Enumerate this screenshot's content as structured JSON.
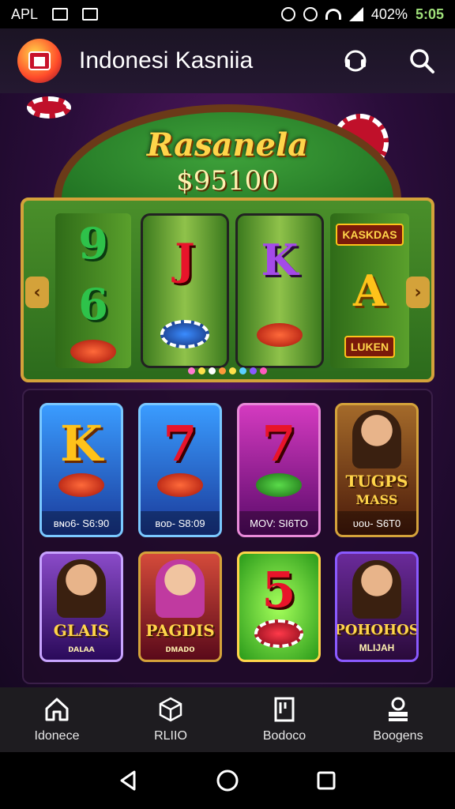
{
  "status_bar": {
    "carrier": "APL",
    "battery": "402%",
    "time": "5:05"
  },
  "app_bar": {
    "title": "Indonesi Kasniia"
  },
  "banner": {
    "title": "Rasanela",
    "amount": "$95100"
  },
  "slot": {
    "reel1_symbols": [
      "9",
      "6"
    ],
    "reel2_symbols": [
      "J"
    ],
    "reel3_symbols": [
      "K"
    ],
    "reel4_symbols": [
      "A"
    ],
    "reel4_badge": "KASKDAS",
    "reel4_bottom_badge": "LUKEN"
  },
  "game_cards": [
    {
      "symbol": "K",
      "caption": "ʙɴᴏ6- S6:90"
    },
    {
      "symbol": "7",
      "caption": "ʙᴏᴅ- S8:09"
    },
    {
      "symbol": "7",
      "caption": "MOV: SI6TO"
    },
    {
      "title": "TUGPS",
      "subtitle": "MASS",
      "caption": "ᴜᴏᴜ- S6T0"
    },
    {
      "title": "GLAIS",
      "subtitle": "ᴅᴀʟᴀᴀ"
    },
    {
      "title": "PAGDIS",
      "subtitle": "ᴅᴍᴀᴅᴏ"
    },
    {
      "symbol": "5"
    },
    {
      "title": "POHOHOS",
      "subtitle": "MLIJAH"
    }
  ],
  "bottom_nav": [
    {
      "label": "Idonece",
      "icon": "home-icon"
    },
    {
      "label": "RLIIO",
      "icon": "cube-icon"
    },
    {
      "label": "Bodoco",
      "icon": "book-icon"
    },
    {
      "label": "Boogens",
      "icon": "profile-icon"
    }
  ],
  "colors": {
    "accent_gold": "#d4a23a",
    "felt_green": "#2c6b1c",
    "bg_purple": "#2a0d3a"
  }
}
